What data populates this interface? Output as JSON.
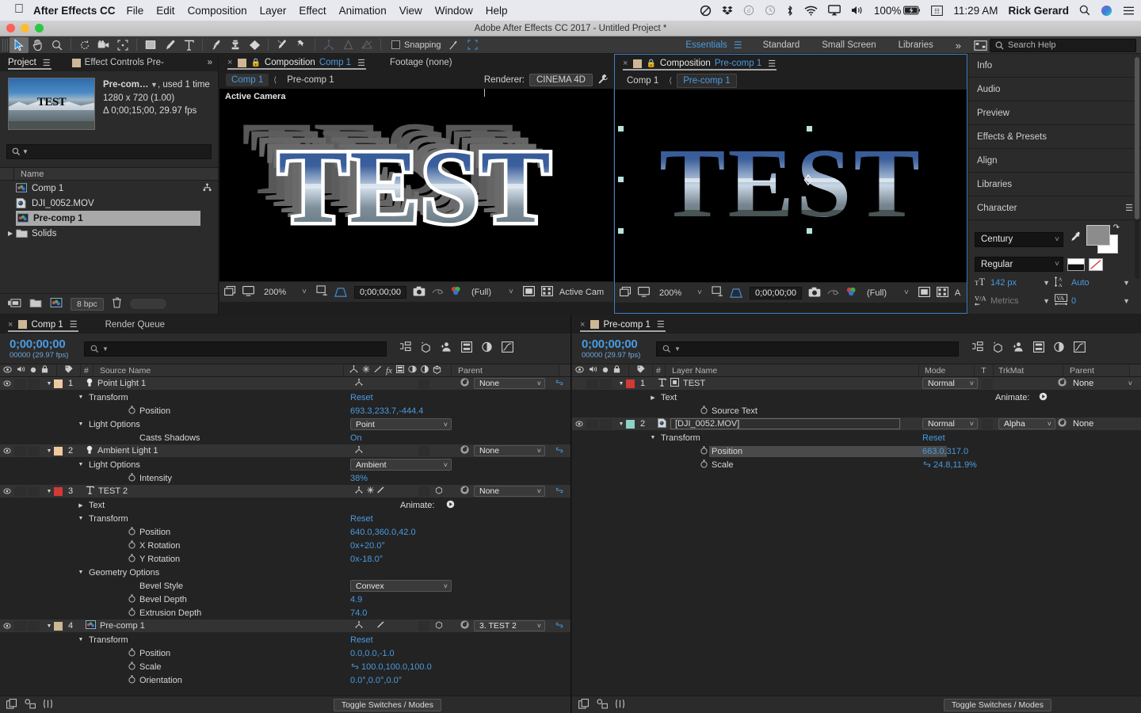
{
  "macmenu": {
    "apple": "apple-logo",
    "app": "After Effects CC",
    "items": [
      "File",
      "Edit",
      "Composition",
      "Layer",
      "Effect",
      "Animation",
      "View",
      "Window",
      "Help"
    ],
    "battery": "100%",
    "clock": "11:29 AM",
    "user": "Rick Gerard"
  },
  "window": {
    "title": "Adobe After Effects CC 2017 - Untitled Project *"
  },
  "toolbar": {
    "snapping_label": "Snapping",
    "workspaces": [
      "Essentials",
      "Standard",
      "Small Screen",
      "Libraries"
    ],
    "active_workspace": "Essentials",
    "overflow": "»",
    "search_placeholder": "Search Help"
  },
  "project": {
    "tab": "Project",
    "tab2": "Effect Controls Pre-",
    "overflow": "»",
    "thumb_text": "TEST",
    "meta_name": "Pre-com…",
    "meta_used": ", used 1 time",
    "meta_dims": "1280 x 720 (1.00)",
    "meta_dur": "Δ 0;00;15;00, 29.97 fps",
    "search_placeholder": "",
    "column": "Name",
    "items": [
      {
        "label": "Comp 1",
        "icon": "comp-icon",
        "selected": false
      },
      {
        "label": "DJI_0052.MOV",
        "icon": "footage-icon",
        "selected": false
      },
      {
        "label": "Pre-comp 1",
        "icon": "comp-icon",
        "selected": true
      },
      {
        "label": "Solids",
        "icon": "folder-icon",
        "selected": false
      }
    ],
    "bpc": "8 bpc"
  },
  "comp1": {
    "tab_label": "Composition",
    "tab_name": "Comp 1",
    "tab2": "Footage (none)",
    "crumbs": [
      "Comp 1",
      "Pre-comp 1"
    ],
    "renderer_label": "Renderer:",
    "renderer_value": "CINEMA 4D",
    "view_label": "Active Camera",
    "art_text": "TEST",
    "footer": {
      "zoom": "200%",
      "time": "0;00;00;00",
      "resolution": "(Full)",
      "view": "Active Cam"
    }
  },
  "comp2": {
    "tab_label": "Composition",
    "tab_name": "Pre-comp 1",
    "crumbs": [
      "Comp 1",
      "Pre-comp 1"
    ],
    "art_text": "TEST",
    "footer": {
      "zoom": "200%",
      "time": "0;00;00;00",
      "resolution": "(Full)",
      "view": "A"
    }
  },
  "dock": {
    "panels": [
      "Info",
      "Audio",
      "Preview",
      "Effects & Presets",
      "Align",
      "Libraries"
    ],
    "character": {
      "title": "Character",
      "font": "Century",
      "style": "Regular",
      "size": "142 px",
      "leading": "Auto",
      "kerning": "Metrics",
      "tracking": "0"
    }
  },
  "timeline1": {
    "tab": "Comp 1",
    "tab2": "Render Queue",
    "time_big": "0;00;00;00",
    "time_small": "00000 (29.97 fps)",
    "search_placeholder": "",
    "columns": {
      "num": "#",
      "source": "Source Name",
      "parent": "Parent"
    },
    "toggle_label": "Toggle Switches / Modes",
    "rows": [
      {
        "kind": "layer",
        "num": "1",
        "name": "Point Light 1",
        "color": "#f0c9a0",
        "icon": "light-icon",
        "parent": "None",
        "indent": 0
      },
      {
        "kind": "group",
        "name": "Transform",
        "value": "Reset",
        "indent": 1
      },
      {
        "kind": "prop",
        "name": "Position",
        "value": "693.3,233.7,-444.4",
        "indent": 2
      },
      {
        "kind": "group",
        "name": "Light Options",
        "dropdown": "Point",
        "indent": 1
      },
      {
        "kind": "prop2",
        "name": "Casts Shadows",
        "value": "On",
        "indent": 2
      },
      {
        "kind": "layer",
        "num": "2",
        "name": "Ambient Light 1",
        "color": "#f0c9a0",
        "icon": "light-icon",
        "parent": "None",
        "indent": 0
      },
      {
        "kind": "group",
        "name": "Light Options",
        "dropdown": "Ambient",
        "indent": 1
      },
      {
        "kind": "prop",
        "name": "Intensity",
        "value": "38%",
        "indent": 2
      },
      {
        "kind": "layer",
        "num": "3",
        "name": "TEST 2",
        "color": "#d13a35",
        "icon": "text-icon",
        "parent": "None",
        "indent": 0
      },
      {
        "kind": "groupc",
        "name": "Text",
        "value": "Animate:",
        "indent": 1
      },
      {
        "kind": "group",
        "name": "Transform",
        "value": "Reset",
        "indent": 1
      },
      {
        "kind": "prop",
        "name": "Position",
        "value": "640.0,360.0,42.0",
        "indent": 2
      },
      {
        "kind": "prop",
        "name": "X Rotation",
        "value": "0x+20.0°",
        "indent": 2
      },
      {
        "kind": "prop",
        "name": "Y Rotation",
        "value": "0x-18.0°",
        "indent": 2
      },
      {
        "kind": "group",
        "name": "Geometry Options",
        "value": "",
        "indent": 1
      },
      {
        "kind": "prop2",
        "name": "Bevel Style",
        "dropdown": "Convex",
        "indent": 2
      },
      {
        "kind": "prop",
        "name": "Bevel Depth",
        "value": "4.9",
        "indent": 2
      },
      {
        "kind": "prop",
        "name": "Extrusion Depth",
        "value": "74.0",
        "indent": 2
      },
      {
        "kind": "layer",
        "num": "4",
        "name": "Pre-comp 1",
        "color": "#cdb795",
        "icon": "comp-icon",
        "parent": "3. TEST 2",
        "indent": 0
      },
      {
        "kind": "group",
        "name": "Transform",
        "value": "Reset",
        "indent": 1
      },
      {
        "kind": "prop",
        "name": "Position",
        "value": "0.0,0.0,-1.0",
        "indent": 2
      },
      {
        "kind": "prop",
        "name": "Scale",
        "value": "100.0,100.0,100.0",
        "link": true,
        "indent": 2
      },
      {
        "kind": "prop",
        "name": "Orientation",
        "value": "0.0°,0.0°,0.0°",
        "indent": 2
      }
    ]
  },
  "timeline2": {
    "tab": "Pre-comp 1",
    "time_big": "0;00;00;00",
    "time_small": "00000 (29.97 fps)",
    "search_placeholder": "",
    "columns": {
      "num": "#",
      "layer": "Layer Name",
      "mode": "Mode",
      "t": "T",
      "trkmat": "TrkMat",
      "parent": "Parent"
    },
    "toggle_label": "Toggle Switches / Modes",
    "rows": [
      {
        "kind": "layer",
        "num": "1",
        "name": "TEST",
        "color": "#d13a35",
        "icon": "text-icon",
        "mode": "Normal",
        "trkmat": "",
        "parent": "None",
        "indent": 0
      },
      {
        "kind": "groupc",
        "name": "Text",
        "value": "Animate:",
        "indent": 1
      },
      {
        "kind": "prop",
        "name": "Source Text",
        "value": "",
        "indent": 2
      },
      {
        "kind": "layer",
        "num": "2",
        "name": "[DJI_0052.MOV]",
        "color": "#8fd0cb",
        "icon": "footage-icon",
        "mode": "Normal",
        "trkmat": "Alpha",
        "parent": "None",
        "indent": 0,
        "namebox": true
      },
      {
        "kind": "group",
        "name": "Transform",
        "value": "Reset",
        "indent": 1
      },
      {
        "kind": "prop",
        "name": "Position",
        "value": "663.0,317.0",
        "indent": 2,
        "highlight": true
      },
      {
        "kind": "prop",
        "name": "Scale",
        "value": "24.8,11.9%",
        "link": true,
        "indent": 2
      }
    ]
  }
}
